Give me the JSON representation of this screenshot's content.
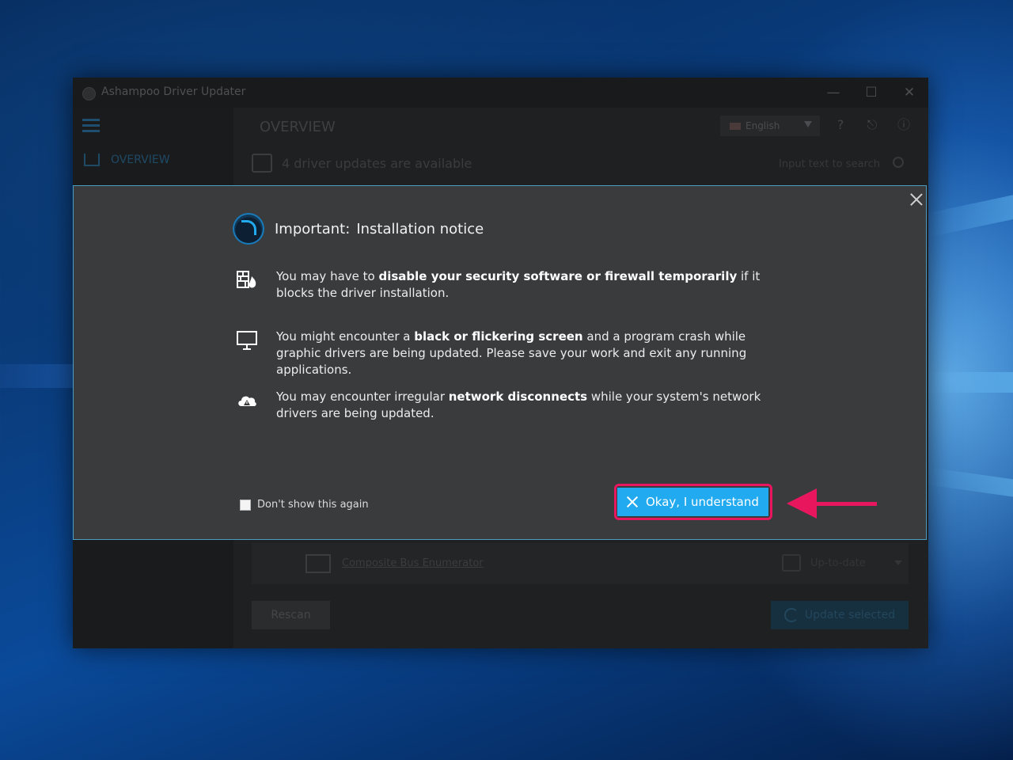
{
  "app": {
    "title": "Ashampoo Driver Updater",
    "nav_overview": "OVERVIEW",
    "page_title": "OVERVIEW",
    "language": "English",
    "status": "4 driver updates are available",
    "search_placeholder": "Input text to search",
    "device_row": {
      "name": "Composite Bus Enumerator",
      "status": "Up-to-date"
    },
    "rescan_label": "Rescan",
    "update_label": "Update selected"
  },
  "modal": {
    "heading_prefix": "Important:",
    "heading": "Installation notice",
    "notices": [
      {
        "icon": "firewall-icon",
        "before": "You may have to ",
        "bold": "disable your security software or firewall temporarily",
        "after": " if it blocks the driver installation."
      },
      {
        "icon": "monitor-icon",
        "before": "You might encounter a ",
        "bold": "black or flickering screen",
        "after": " and a program crash while graphic drivers are being updated. Please save your work and exit any running applications."
      },
      {
        "icon": "cloud-warning-icon",
        "before": "You may encounter irregular ",
        "bold": "network disconnects",
        "after": " while your system's network drivers are being updated."
      }
    ],
    "dont_show_label": "Don't show this again",
    "ok_label": "Okay, I understand"
  },
  "colors": {
    "accent": "#22aaf0",
    "annotation": "#e8175d",
    "modal_bg": "#3a3b3d"
  }
}
